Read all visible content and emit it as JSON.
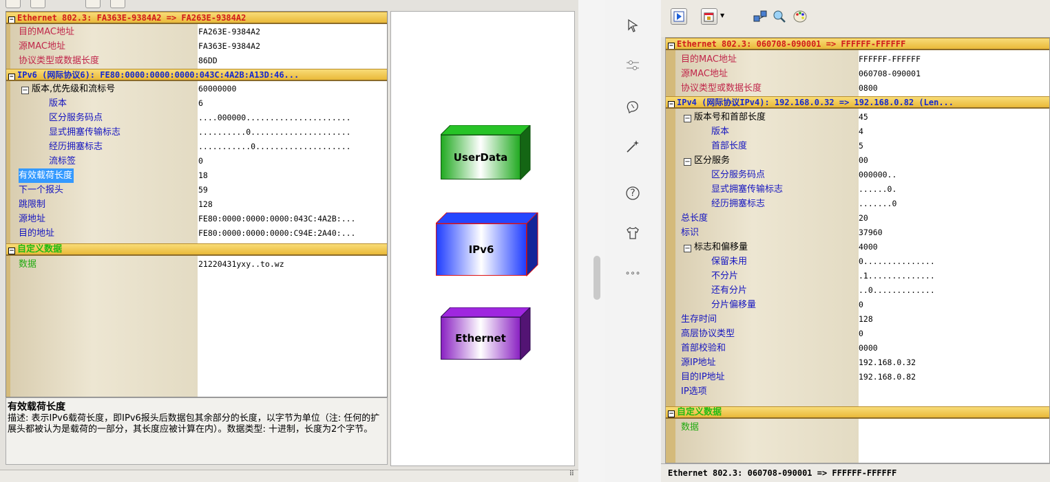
{
  "left": {
    "tree": {
      "ethernet_header": "Ethernet 802.3: FA363E-9384A2 => FA263E-9384A2",
      "ethernet_rows": [
        {
          "label": "目的MAC地址",
          "value": "FA263E-9384A2"
        },
        {
          "label": "源MAC地址",
          "value": "FA363E-9384A2"
        },
        {
          "label": "协议类型或数据长度",
          "value": "86DD"
        }
      ],
      "ipv6_header": "IPv6 (网际协议6): FE80:0000:0000:0000:043C:4A2B:A13D:46...",
      "ipv6_rows": [
        {
          "label": "版本,优先级和流标号",
          "value": "60000000",
          "toggle": "⊟",
          "indent": 1
        },
        {
          "label": "版本",
          "value": "6",
          "indent": 2
        },
        {
          "label": "区分服务码点",
          "value": "....000000......................",
          "indent": 2
        },
        {
          "label": "显式拥塞传输标志",
          "value": "..........0.....................",
          "indent": 2
        },
        {
          "label": "经历拥塞标志",
          "value": "...........0....................",
          "indent": 2
        },
        {
          "label": "流标签",
          "value": "0",
          "indent": 2
        },
        {
          "label": "有效载荷长度",
          "value": "18",
          "indent": 0,
          "selected": true
        },
        {
          "label": "下一个报头",
          "value": "59",
          "indent": 0
        },
        {
          "label": "跳限制",
          "value": "128",
          "indent": 0
        },
        {
          "label": "源地址",
          "value": "FE80:0000:0000:0000:043C:4A2B:...",
          "indent": 0
        },
        {
          "label": "目的地址",
          "value": "FE80:0000:0000:0000:C94E:2A40:...",
          "indent": 0
        }
      ],
      "custom_header": "自定义数据",
      "custom_rows": [
        {
          "label": "数据",
          "value": "21220431yxy..to.wz"
        }
      ]
    },
    "description": {
      "title": "有效载荷长度",
      "body": "描述: 表示IPv6载荷长度，即IPv6报头后数据包其余部分的长度，以字节为单位（注: 任何的扩展头都被认为是载荷的一部分，其长度应被计算在内）。数据类型: 十进制，长度为2个字节。"
    },
    "layers": [
      {
        "label": "UserData",
        "color": "#22aa22"
      },
      {
        "label": "IPv6",
        "color": "#1f3dff"
      },
      {
        "label": "Ethernet",
        "color": "#8a22c2"
      }
    ]
  },
  "sidebar": {
    "icons": [
      "cursor-arrow-icon",
      "slider-icon",
      "brain-icon",
      "magic-wand-icon",
      "help-icon",
      "shirt-icon",
      "more-icon"
    ],
    "help_glyph": "?",
    "more_glyph": "∘∘∘"
  },
  "right": {
    "toolbar": [
      "play-icon",
      "capture-icon",
      "network-icon",
      "search-icon",
      "palette-icon"
    ],
    "tree": {
      "ethernet_header": "Ethernet 802.3: 060708-090001 => FFFFFF-FFFFFF",
      "ethernet_rows": [
        {
          "label": "目的MAC地址",
          "value": "FFFFFF-FFFFFF"
        },
        {
          "label": "源MAC地址",
          "value": "060708-090001"
        },
        {
          "label": "协议类型或数据长度",
          "value": "0800"
        }
      ],
      "ipv4_header": "IPv4 (网际协议IPv4): 192.168.0.32 => 192.168.0.82 (Len...",
      "ipv4_rows": [
        {
          "label": "版本号和首部长度",
          "value": "45",
          "toggle": "⊟",
          "indent": 1
        },
        {
          "label": "版本",
          "value": "4",
          "indent": 2
        },
        {
          "label": "首部长度",
          "value": "5",
          "indent": 2
        },
        {
          "label": "区分服务",
          "value": "00",
          "toggle": "⊟",
          "indent": 1
        },
        {
          "label": "区分服务码点",
          "value": "000000..",
          "indent": 2
        },
        {
          "label": "显式拥塞传输标志",
          "value": "......0.",
          "indent": 2
        },
        {
          "label": "经历拥塞标志",
          "value": ".......0",
          "indent": 2
        },
        {
          "label": "总长度",
          "value": "20",
          "indent": 0
        },
        {
          "label": "标识",
          "value": "37960",
          "indent": 0
        },
        {
          "label": "标志和偏移量",
          "value": "4000",
          "toggle": "⊟",
          "indent": 1
        },
        {
          "label": "保留未用",
          "value": "0...............",
          "indent": 2
        },
        {
          "label": "不分片",
          "value": ".1..............",
          "indent": 2
        },
        {
          "label": "还有分片",
          "value": "..0.............",
          "indent": 2
        },
        {
          "label": "分片偏移量",
          "value": "0",
          "indent": 2
        },
        {
          "label": "生存时间",
          "value": "128",
          "indent": 0
        },
        {
          "label": "高层协议类型",
          "value": "0",
          "indent": 0
        },
        {
          "label": "首部校验和",
          "value": "0000",
          "indent": 0
        },
        {
          "label": "源IP地址",
          "value": "192.168.0.32",
          "indent": 0
        },
        {
          "label": "目的IP地址",
          "value": "192.168.0.82",
          "indent": 0
        },
        {
          "label": "IP选项",
          "value": "",
          "indent": 0
        }
      ],
      "custom_header": "自定义数据",
      "custom_rows": [
        {
          "label": "数据",
          "value": ""
        }
      ]
    },
    "status": "Ethernet 802.3: 060708-090001 => FFFFFF-FFFFFF"
  }
}
